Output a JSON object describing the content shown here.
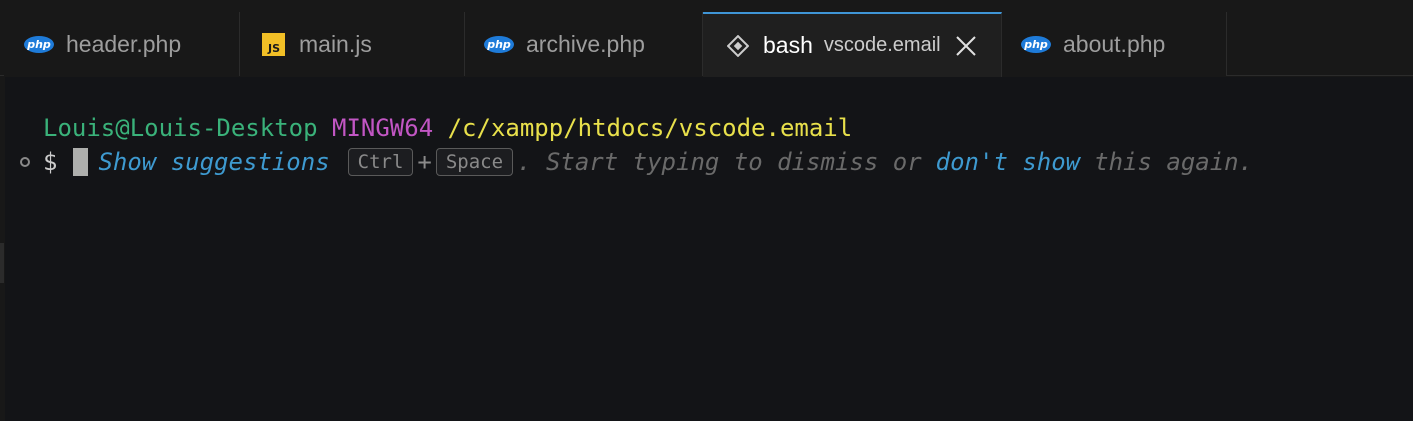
{
  "tabs": [
    {
      "label": "header.php",
      "icon": "php-icon",
      "icon_text": "php"
    },
    {
      "label": "main.js",
      "icon": "js-icon",
      "icon_text": "JS"
    },
    {
      "label": "archive.php",
      "icon": "php-icon",
      "icon_text": "php"
    },
    {
      "label": "bash",
      "description": "vscode.email",
      "icon": "git-bash-icon",
      "active": true
    },
    {
      "label": "about.php",
      "icon": "php-icon",
      "icon_text": "php"
    }
  ],
  "terminal": {
    "prompt": {
      "user": "Louis@Louis-Desktop",
      "system": "MINGW64",
      "path": "/c/xampp/htdocs/vscode.email"
    },
    "dollar": "$",
    "hint": {
      "show_suggestions": "Show suggestions",
      "key1": "Ctrl",
      "plus": "+",
      "key2": "Space",
      "middle": ". Start typing to dismiss or",
      "dont_show": "don't show",
      "end": "this again."
    }
  },
  "colors": {
    "user": "#3ab27a",
    "system": "#c256c4",
    "path": "#e8e04b",
    "link": "#3e9ad0",
    "active_tab_border": "#3f95d6"
  }
}
